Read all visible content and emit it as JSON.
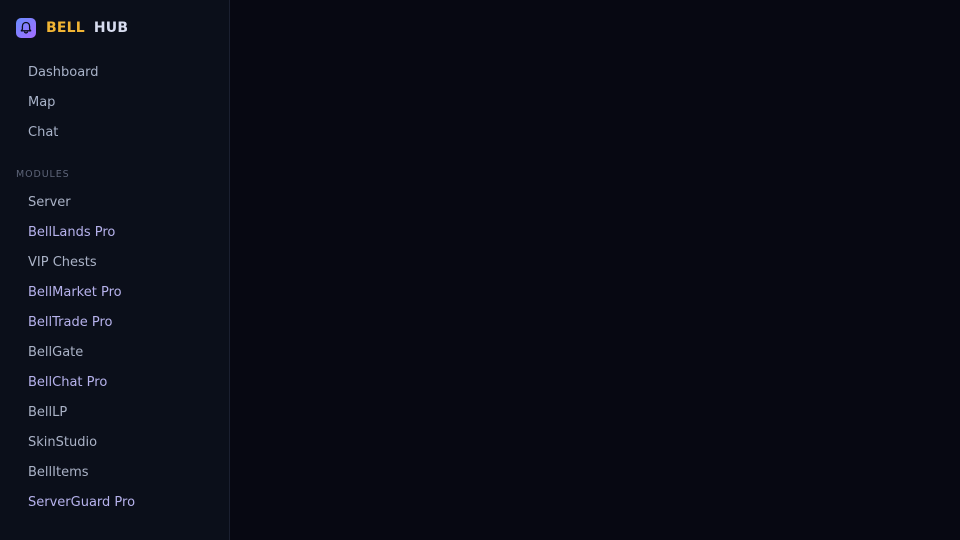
{
  "brand": {
    "logo_icon": "bell-icon",
    "bell": "BELL",
    "hub": "HUB",
    "accent_color": "#f2b534"
  },
  "nav": {
    "items": [
      {
        "label": "Dashboard"
      },
      {
        "label": "Map"
      },
      {
        "label": "Chat"
      }
    ]
  },
  "modules": {
    "heading": "MODULES",
    "items": [
      {
        "label": "Server"
      },
      {
        "label": "BellLands Pro"
      },
      {
        "label": "VIP Chests"
      },
      {
        "label": "BellMarket Pro"
      },
      {
        "label": "BellTrade Pro"
      },
      {
        "label": "BellGate"
      },
      {
        "label": "BellChat Pro"
      },
      {
        "label": "BellLP"
      },
      {
        "label": "SkinStudio"
      },
      {
        "label": "BellItems"
      },
      {
        "label": "ServerGuard Pro"
      }
    ]
  }
}
